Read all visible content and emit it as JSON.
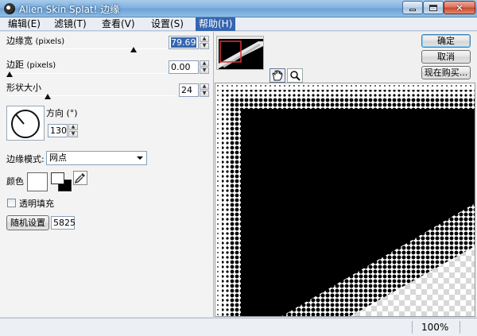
{
  "window": {
    "title": "Alien Skin Splat! 边缘"
  },
  "menu": {
    "items": [
      {
        "label": "编辑(E)"
      },
      {
        "label": "滤镜(T)"
      },
      {
        "label": "查看(V)"
      },
      {
        "label": "设置(S)"
      },
      {
        "label": "帮助(H)"
      }
    ]
  },
  "controls": {
    "edge_width": {
      "label": "边缘宽",
      "unit": "(pixels)",
      "value": "79.69"
    },
    "edge_distance": {
      "label": "边距",
      "unit": "(pixels)",
      "value": "0.00"
    },
    "shape_size": {
      "label": "形状大小",
      "value": "24"
    },
    "direction": {
      "label": "方向",
      "unit": "(°)",
      "value": "130"
    },
    "edge_mode": {
      "label": "边缘模式:",
      "value": "网点"
    },
    "color": {
      "label": "颜色"
    },
    "transparent_fill": {
      "label": "透明填充",
      "checked": false
    },
    "random": {
      "button": "随机设置",
      "seed": "5825"
    }
  },
  "buttons": {
    "ok": "确定",
    "cancel": "取消",
    "buy": "现在购买..."
  },
  "status": {
    "zoom": "100%"
  },
  "colors": {
    "accent": "#3566b0",
    "preview_fill": "#000000"
  }
}
